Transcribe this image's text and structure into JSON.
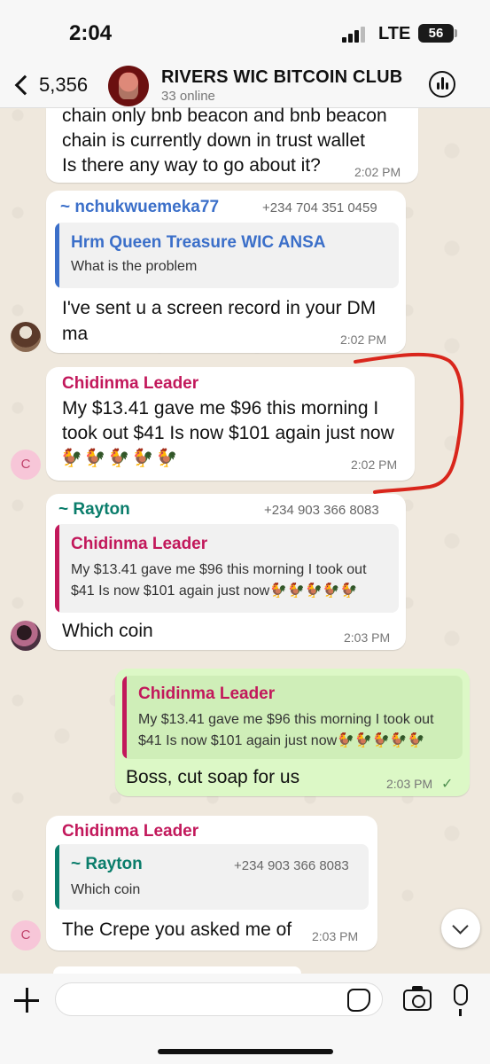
{
  "status_bar": {
    "time": "2:04",
    "network": "LTE",
    "battery": "56"
  },
  "header": {
    "back_count": "5,356",
    "group_name": "RIVERS WIC BITCOIN CLUB",
    "subtitle": "33 online"
  },
  "messages": [
    {
      "id": "m0",
      "text_lines": [
        "chain only bnb beacon and bnb beacon",
        "chain is currently down in trust wallet",
        "Is there any way to go about it?"
      ],
      "time": "2:02 PM"
    },
    {
      "id": "m1",
      "sender": "~ nchukwuemeka77",
      "phone": "+234 704 351 0459",
      "quote": {
        "name": "Hrm Queen Treasure WIC ANSA",
        "text": "What is the problem"
      },
      "text_lines": [
        "I've sent u a screen record in your DM",
        "ma"
      ],
      "time": "2:02 PM"
    },
    {
      "id": "m2",
      "sender": "Chidinma Leader",
      "text_lines": [
        "My $13.41 gave me $96 this morning I",
        "took out $41 Is now $101 again just now"
      ],
      "emoji": "🐓🐓🐓🐓🐓",
      "time": "2:02 PM",
      "avatar": "C"
    },
    {
      "id": "m3",
      "sender": "~ Rayton",
      "phone": "+234 903 366 8083",
      "quote": {
        "name": "Chidinma Leader",
        "text_lines": [
          "My $13.41 gave me $96 this morning I took out",
          "$41 Is now $101 again just now🐓🐓🐓🐓🐓"
        ]
      },
      "text": "Which coin",
      "time": "2:03 PM"
    },
    {
      "id": "m4",
      "outgoing": true,
      "quote": {
        "name": "Chidinma Leader",
        "text_lines": [
          "My $13.41 gave me $96 this morning I took out",
          "$41 Is now $101 again just now🐓🐓🐓🐓🐓"
        ]
      },
      "text": "Boss, cut soap for us",
      "time": "2:03 PM",
      "status": "✓"
    },
    {
      "id": "m5",
      "sender": "Chidinma Leader",
      "quote": {
        "name": "~ Rayton",
        "phone": "+234 903 366 8083",
        "text": "Which coin"
      },
      "text": "The Crepe you asked me of",
      "time": "2:03 PM",
      "avatar": "C"
    }
  ],
  "colors": {
    "accent_blue": "#3b6fc9",
    "sender_pink": "#c2185b",
    "sender_teal": "#0a7d6b",
    "outgoing_bubble": "#dcf8c6",
    "annotation_red": "#d9261c"
  },
  "composer": {
    "placeholder": ""
  }
}
